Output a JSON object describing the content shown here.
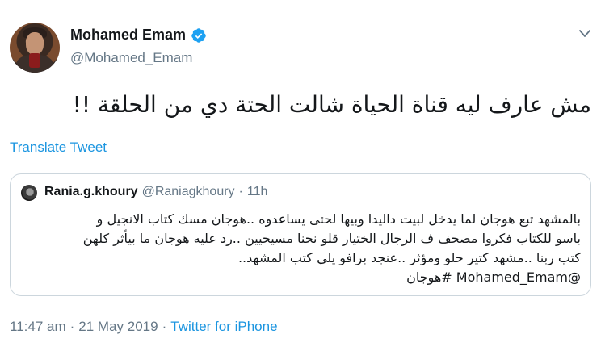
{
  "author": {
    "display_name": "Mohamed Emam",
    "handle": "@Mohamed_Emam",
    "verified": true
  },
  "tweet": {
    "text": "مش عارف ليه قناة الحياة شالت الحتة دي من الحلقة !!",
    "translate_label": "Translate Tweet"
  },
  "quoted_tweet": {
    "display_name": "Rania.g.khoury",
    "handle": "@Raniagkhoury",
    "separator": "·",
    "time": "11h",
    "lines": [
      "بالمشهد تبع هوجان لما يدخل لبيت داليدا وبيها لحتى يساعدوه ..هوجان مسك كتاب الانجيل و",
      "باسو للكتاب فكروا مصحف ف الرجال الختيار قلو نحنا مسيحيين ..رد عليه هوجان ما بيأثر كلهن",
      "كتب ربنا ..مشهد كتير حلو ومؤثر ..عنجد برافو يلي كتب المشهد..",
      "@Mohamed_Emam #هوجان"
    ]
  },
  "meta": {
    "time": "11:47 am",
    "separator": "·",
    "date": "21 May 2019",
    "separator2": "·",
    "source": "Twitter for iPhone"
  },
  "colors": {
    "link": "#1b95e0",
    "muted": "#657786",
    "text": "#14171a",
    "border": "#ccd6dd"
  },
  "icons": [
    "verified-badge-icon",
    "chevron-down-icon"
  ]
}
